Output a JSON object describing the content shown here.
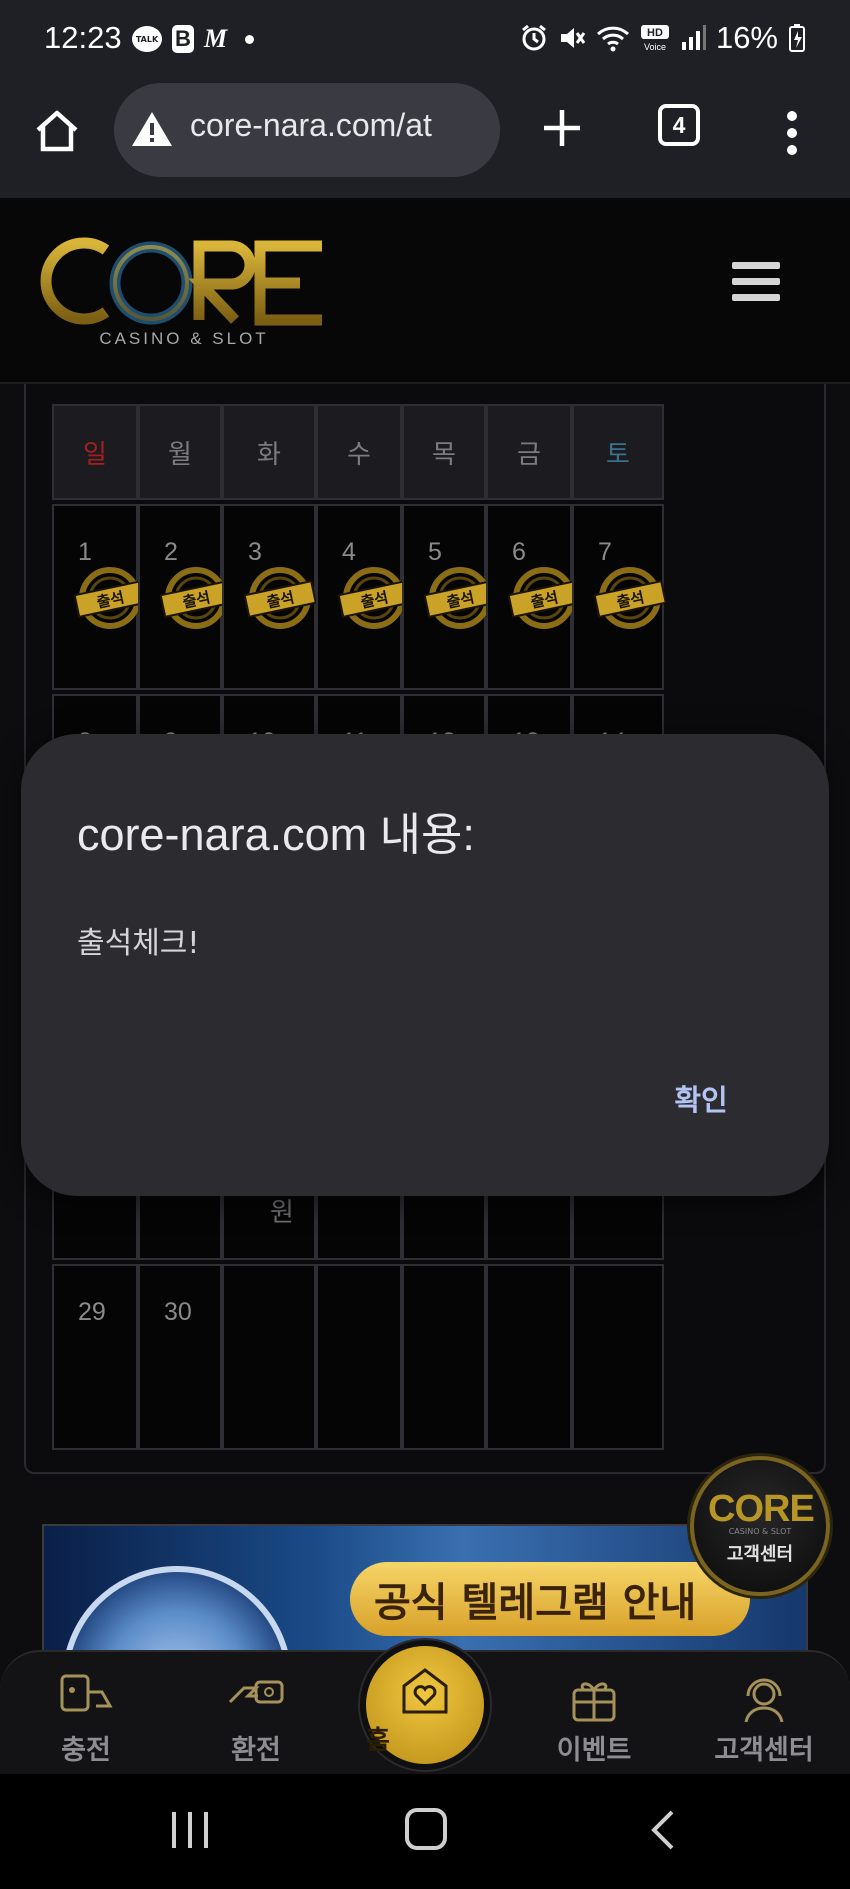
{
  "status_bar": {
    "time": "12:23",
    "talk_badge": "TALK",
    "b_app": "B",
    "m_app": "M",
    "battery": "16%",
    "icons": [
      "alarm-icon",
      "mute-icon",
      "wifi-icon",
      "hd-voice-icon",
      "signal-icon",
      "battery-icon"
    ]
  },
  "browser": {
    "url": "core-nara.com/at",
    "tab_count": "4"
  },
  "site": {
    "logo_text": "CORE",
    "logo_sub": "CASINO & SLOT"
  },
  "calendar": {
    "weekdays": [
      "일",
      "월",
      "화",
      "수",
      "목",
      "금",
      "토"
    ],
    "weekday_colors": {
      "sun": "#a31f1f",
      "sat": "#3b6f8f",
      "default": "#7c7c80"
    },
    "week1": [
      "1",
      "2",
      "3",
      "4",
      "5",
      "6",
      "7"
    ],
    "stamp_text": "출석",
    "week2_partial": [
      "8",
      "9",
      "10",
      "11",
      "12",
      "13",
      "14"
    ],
    "week4_extra": "원",
    "week5": [
      "29",
      "30",
      "",
      "",
      "",
      "",
      ""
    ]
  },
  "chat_badge": {
    "logo": "CORE",
    "sub": "CASINO & SLOT",
    "label": "고객센터"
  },
  "banner": {
    "text": "공식 텔레그램 안내"
  },
  "bottom_nav": {
    "items": [
      {
        "label": "충전",
        "icon": "charge-icon"
      },
      {
        "label": "환전",
        "icon": "exchange-icon"
      },
      {
        "label": "홈",
        "icon": "home-heart-icon"
      },
      {
        "label": "이벤트",
        "icon": "gift-icon"
      },
      {
        "label": "고객센터",
        "icon": "support-icon"
      }
    ]
  },
  "dialog": {
    "title": "core-nara.com 내용:",
    "message": "출석체크!",
    "ok_label": "확인"
  },
  "colors": {
    "accent_gold": "#c9a227",
    "dialog_bg": "#2c2c30",
    "dialog_button": "#b3c4f4"
  }
}
